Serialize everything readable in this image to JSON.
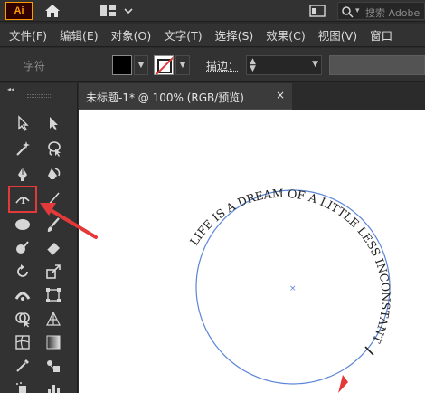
{
  "app": {
    "logo_text": "Ai",
    "search_placeholder": "搜索 Adobe"
  },
  "menu": {
    "items": [
      "文件(F)",
      "编辑(E)",
      "对象(O)",
      "文字(T)",
      "选择(S)",
      "效果(C)",
      "视图(V)",
      "窗口"
    ]
  },
  "control_bar": {
    "label": "字符",
    "stroke_label": "描边："
  },
  "document": {
    "tab_title": "未标题-1* @ 100% (RGB/预览)",
    "close_glyph": "×"
  },
  "canvas": {
    "path_text": "LIFE IS A DREAM OF A LITTLE LESS INCONSTANT",
    "circle_color": "#5b86d6",
    "text_color": "#222222",
    "center_mark": "×"
  },
  "annotation": {
    "arrow_color": "#e23a3a",
    "highlight_tool": "path-type-tool"
  },
  "colors": {
    "ui_bg": "#323232",
    "panel_dark": "#2b2b2b",
    "ai_orange": "#ff9a00"
  }
}
